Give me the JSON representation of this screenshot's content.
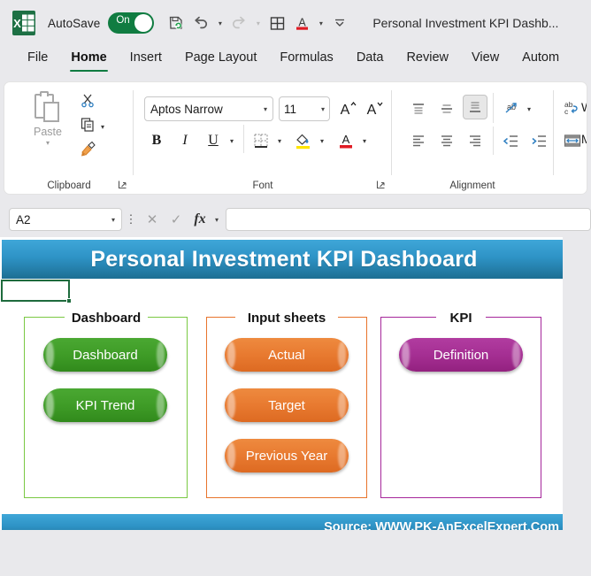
{
  "titlebar": {
    "logo_icon": "excel-logo-icon",
    "autosave_label": "AutoSave",
    "autosave_state": "On",
    "quick_access": [
      {
        "name": "save-refresh-icon",
        "label": ""
      },
      {
        "name": "undo-icon",
        "label": ""
      },
      {
        "name": "redo-icon",
        "label": ""
      },
      {
        "name": "table-grid-icon",
        "label": ""
      },
      {
        "name": "font-color-icon",
        "label": ""
      },
      {
        "name": "customize-quick-access-icon",
        "label": ""
      }
    ],
    "document_title": "Personal Investment KPI Dashb..."
  },
  "ribbon": {
    "tabs": [
      {
        "label": "File",
        "active": false
      },
      {
        "label": "Home",
        "active": true
      },
      {
        "label": "Insert",
        "active": false
      },
      {
        "label": "Page Layout",
        "active": false
      },
      {
        "label": "Formulas",
        "active": false
      },
      {
        "label": "Data",
        "active": false
      },
      {
        "label": "Review",
        "active": false
      },
      {
        "label": "View",
        "active": false
      },
      {
        "label": "Autom",
        "active": false
      }
    ],
    "groups": {
      "clipboard": {
        "label": "Clipboard",
        "paste_label": "Paste",
        "cut_icon": "scissors-icon",
        "copy_icon": "copy-icon",
        "format_painter_icon": "format-painter-icon"
      },
      "font": {
        "label": "Font",
        "font_name": "Aptos Narrow",
        "font_size": "11",
        "bold_label": "B",
        "italic_label": "I",
        "underline_label": "U",
        "grow_font_icon": "increase-font-size-icon",
        "shrink_font_icon": "decrease-font-size-icon",
        "borders_icon": "borders-icon",
        "fill_color_icon": "fill-color-icon",
        "font_color_icon": "font-color-icon"
      },
      "alignment": {
        "label": "Alignment",
        "align_top_icon": "align-top-icon",
        "align_middle_icon": "align-middle-icon",
        "align_bottom_icon": "align-bottom-icon",
        "orientation_icon": "text-orientation-icon",
        "align_left_icon": "align-left-icon",
        "align_center_icon": "align-center-icon",
        "align_right_icon": "align-right-icon",
        "decrease_indent_icon": "decrease-indent-icon",
        "increase_indent_icon": "increase-indent-icon",
        "wrap_text_label": "W",
        "merge_label": "M"
      }
    }
  },
  "formula_bar": {
    "name_box_value": "A2",
    "cancel_icon": "cancel-icon",
    "enter_icon": "confirm-icon",
    "fx_label": "fx",
    "formula_value": "",
    "formula_placeholder": ""
  },
  "sheet": {
    "banner_title": "Personal Investment KPI Dashboard",
    "selected_cell": "A2",
    "footer_source": "Source: WWW.PK-AnExcelExpert.Com",
    "groups": [
      {
        "title": "Dashboard",
        "color": "#7ac943",
        "buttons": [
          {
            "label": "Dashboard",
            "style": "green"
          },
          {
            "label": "KPI Trend",
            "style": "green"
          }
        ]
      },
      {
        "title": "Input sheets",
        "color": "#e8742c",
        "buttons": [
          {
            "label": "Actual",
            "style": "orange"
          },
          {
            "label": "Target",
            "style": "orange"
          },
          {
            "label": "Previous Year",
            "style": "orange"
          }
        ]
      },
      {
        "title": "KPI",
        "color": "#a6279b",
        "buttons": [
          {
            "label": "Definition",
            "style": "purple"
          }
        ]
      }
    ]
  },
  "colors": {
    "banner_top": "#3fa7d8",
    "banner_bottom": "#1d6f93",
    "green_button": "#3f9c27",
    "orange_button": "#e87a30",
    "purple_button": "#a52f93",
    "accent_tab": "#107c41",
    "app_chrome": "#e9e9ec"
  }
}
